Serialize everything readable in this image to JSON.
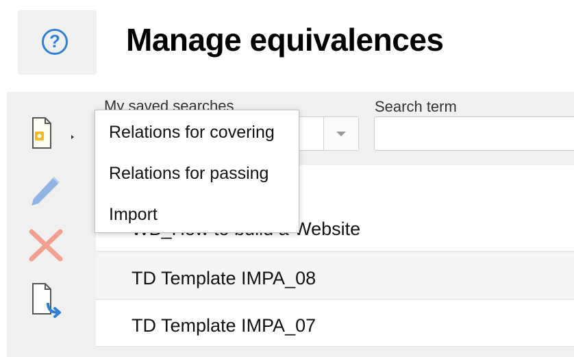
{
  "header": {
    "title": "Manage equivalences",
    "help_icon": "help-circle-icon",
    "help_glyph": "?"
  },
  "toolbar": {
    "new_icon": "new-document-icon",
    "edit_icon": "pencil-icon",
    "delete_icon": "delete-x-icon",
    "export_icon": "export-document-icon"
  },
  "filters": {
    "saved_searches_label": "My saved searches",
    "search_term_label": "Search term",
    "search_placeholder": ""
  },
  "dropdown_menu": {
    "items": [
      {
        "label": "Relations for covering"
      },
      {
        "label": "Relations for passing"
      },
      {
        "label": "Import"
      }
    ]
  },
  "list": {
    "items": [
      {
        "label": ""
      },
      {
        "label": "WB_How to build a Website"
      },
      {
        "label": "TD Template IMPA_08"
      },
      {
        "label": "TD Template IMPA_07"
      }
    ]
  },
  "colors": {
    "accent": "#2f7fd3",
    "delete": "#f0a08c",
    "pencil": "#8eb4e3",
    "doc_badge": "#f2b824"
  }
}
